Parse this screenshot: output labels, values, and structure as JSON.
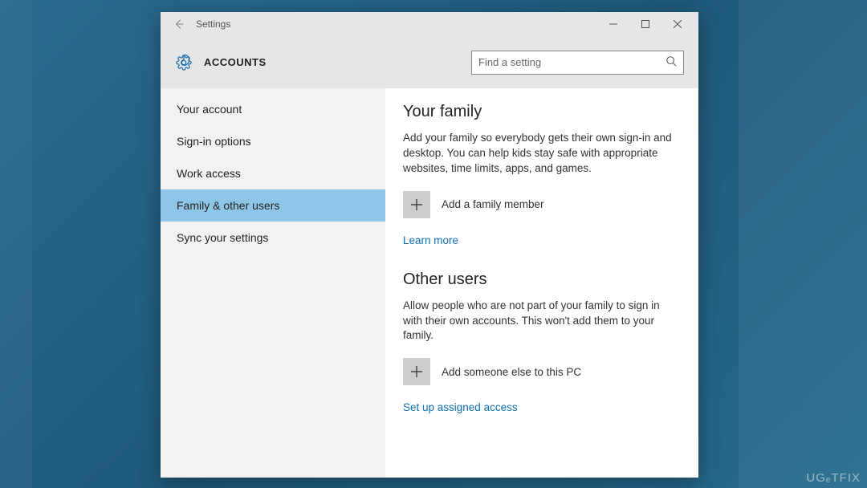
{
  "window": {
    "title": "Settings",
    "section": "ACCOUNTS"
  },
  "search": {
    "placeholder": "Find a setting"
  },
  "sidebar": {
    "items": [
      {
        "label": "Your account",
        "active": false
      },
      {
        "label": "Sign-in options",
        "active": false
      },
      {
        "label": "Work access",
        "active": false
      },
      {
        "label": "Family & other users",
        "active": true
      },
      {
        "label": "Sync your settings",
        "active": false
      }
    ]
  },
  "content": {
    "family": {
      "heading": "Your family",
      "description": "Add your family so everybody gets their own sign-in and desktop. You can help kids stay safe with appropriate websites, time limits, apps, and games.",
      "add_label": "Add a family member",
      "learn_more": "Learn more"
    },
    "other": {
      "heading": "Other users",
      "description": "Allow people who are not part of your family to sign in with their own accounts. This won't add them to your family.",
      "add_label": "Add someone else to this PC",
      "assigned_access": "Set up assigned access"
    }
  },
  "watermark": "UGₑTFIX"
}
